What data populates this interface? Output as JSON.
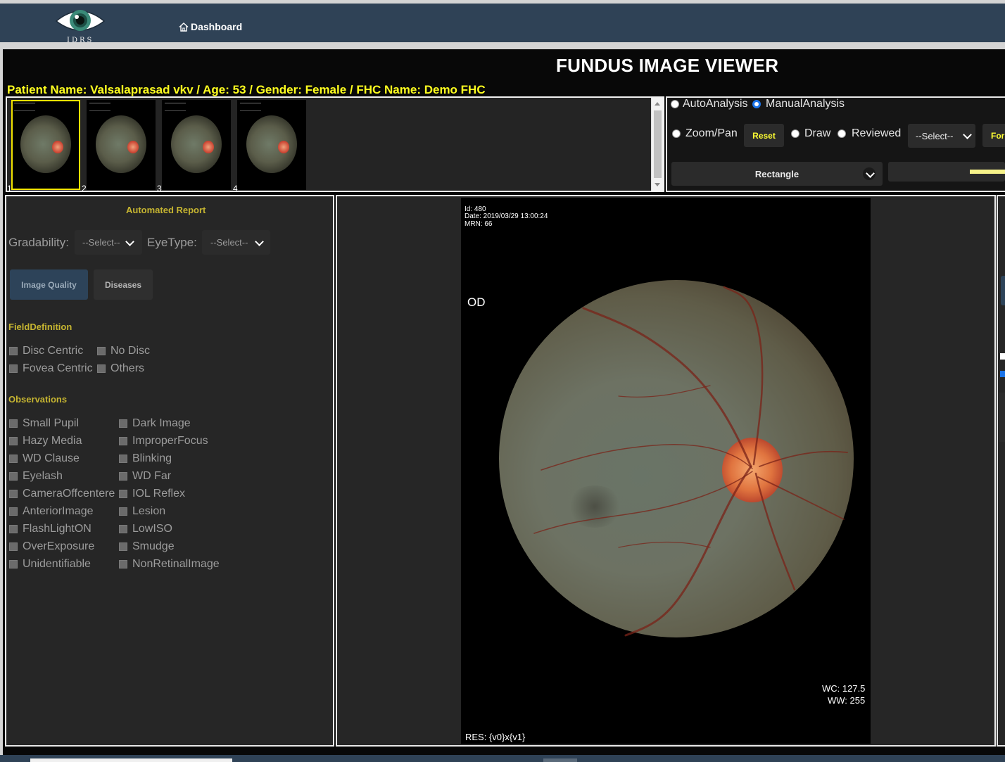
{
  "header": {
    "logo_text": "IDRS",
    "nav_dashboard": "Dashboard"
  },
  "title": "FUNDUS IMAGE VIEWER",
  "patient_info": "Patient Name: Valsalaprasad vkv / Age: 53 / Gender: Female / FHC Name: Demo FHC",
  "thumbnails": [
    {
      "number": "1",
      "selected": true
    },
    {
      "number": "2",
      "selected": false
    },
    {
      "number": "3",
      "selected": false
    },
    {
      "number": "4",
      "selected": false
    }
  ],
  "controls": {
    "auto_analysis": "AutoAnalysis",
    "manual_analysis": "ManualAnalysis",
    "zoom_pan": "Zoom/Pan",
    "reset": "Reset",
    "draw": "Draw",
    "reviewed": "Reviewed",
    "select_placeholder": "--Select--",
    "for_button": "For",
    "shape": "Rectangle",
    "line_color": "#f7f38a"
  },
  "report": {
    "heading": "Automated Report",
    "gradability_label": "Gradability:",
    "gradability_value": "--Select--",
    "eyetype_label": "EyeType:",
    "eyetype_value": "--Select--",
    "tab_image_quality": "Image Quality",
    "tab_diseases": "Diseases",
    "field_definition_heading": "FieldDefinition",
    "field_definition": [
      "Disc Centric",
      "No Disc",
      "Fovea Centric",
      "Others"
    ],
    "observations_heading": "Observations",
    "observations_left": [
      "Small Pupil",
      "Hazy Media",
      "WD Clause",
      "Eyelash",
      "CameraOffcentere",
      "AnteriorImage",
      "FlashLightON",
      "OverExposure",
      "Unidentifiable"
    ],
    "observations_right": [
      "Dark Image",
      "ImproperFocus",
      "Blinking",
      "WD Far",
      "IOL Reflex",
      "Lesion",
      "LowISO",
      "Smudge",
      "NonRetinalImage"
    ]
  },
  "viewer": {
    "id_line": "Id: 480",
    "date_line": "Date: 2019/03/29 13:00:24",
    "mrn_line": "MRN: 66",
    "eye_label": "OD",
    "wc": "WC: 127.5",
    "ww": "WW: 255",
    "res": "RES: {v0}x{v1}"
  },
  "colors": {
    "accent_yellow": "#ffff1f",
    "gold_heading": "#c6b531",
    "topbar": "#2f4256",
    "radio_on": "#1a73e8"
  }
}
